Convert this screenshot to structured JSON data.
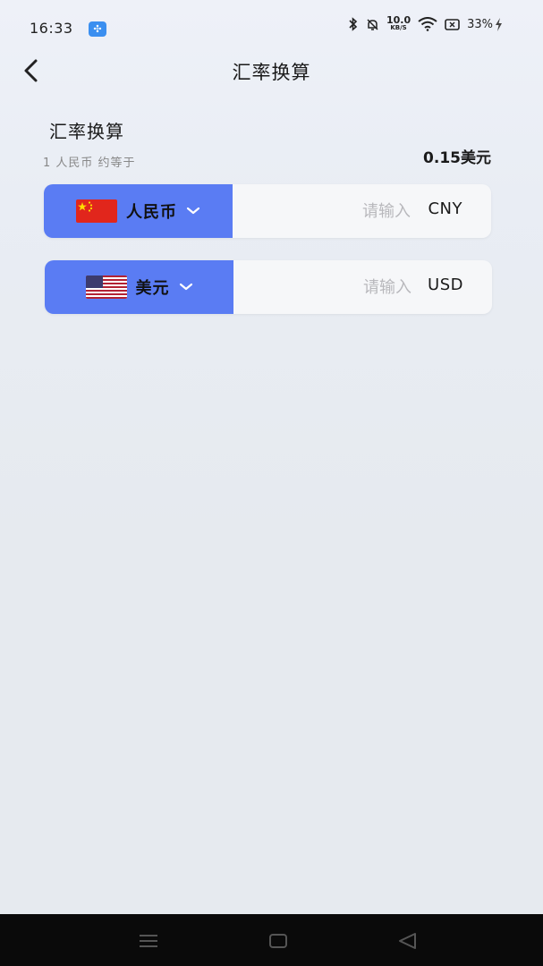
{
  "status_bar": {
    "time": "16:33",
    "net_speed_value": "10.0",
    "net_speed_unit": "KB/S",
    "battery": "33%"
  },
  "nav": {
    "title": "汇率换算"
  },
  "converter": {
    "section_title": "汇率换算",
    "rate_caption": "1 人民币 约等于",
    "rate_result": "0.15美元",
    "rows": [
      {
        "currency_name": "人民币",
        "code": "CNY",
        "placeholder": "请输入",
        "value": "",
        "flag_icon": "china-flag-icon"
      },
      {
        "currency_name": "美元",
        "code": "USD",
        "placeholder": "请输入",
        "value": "",
        "flag_icon": "us-flag-icon"
      }
    ]
  },
  "colors": {
    "accent": "#5a7cf3",
    "background": "#e6eaef"
  }
}
